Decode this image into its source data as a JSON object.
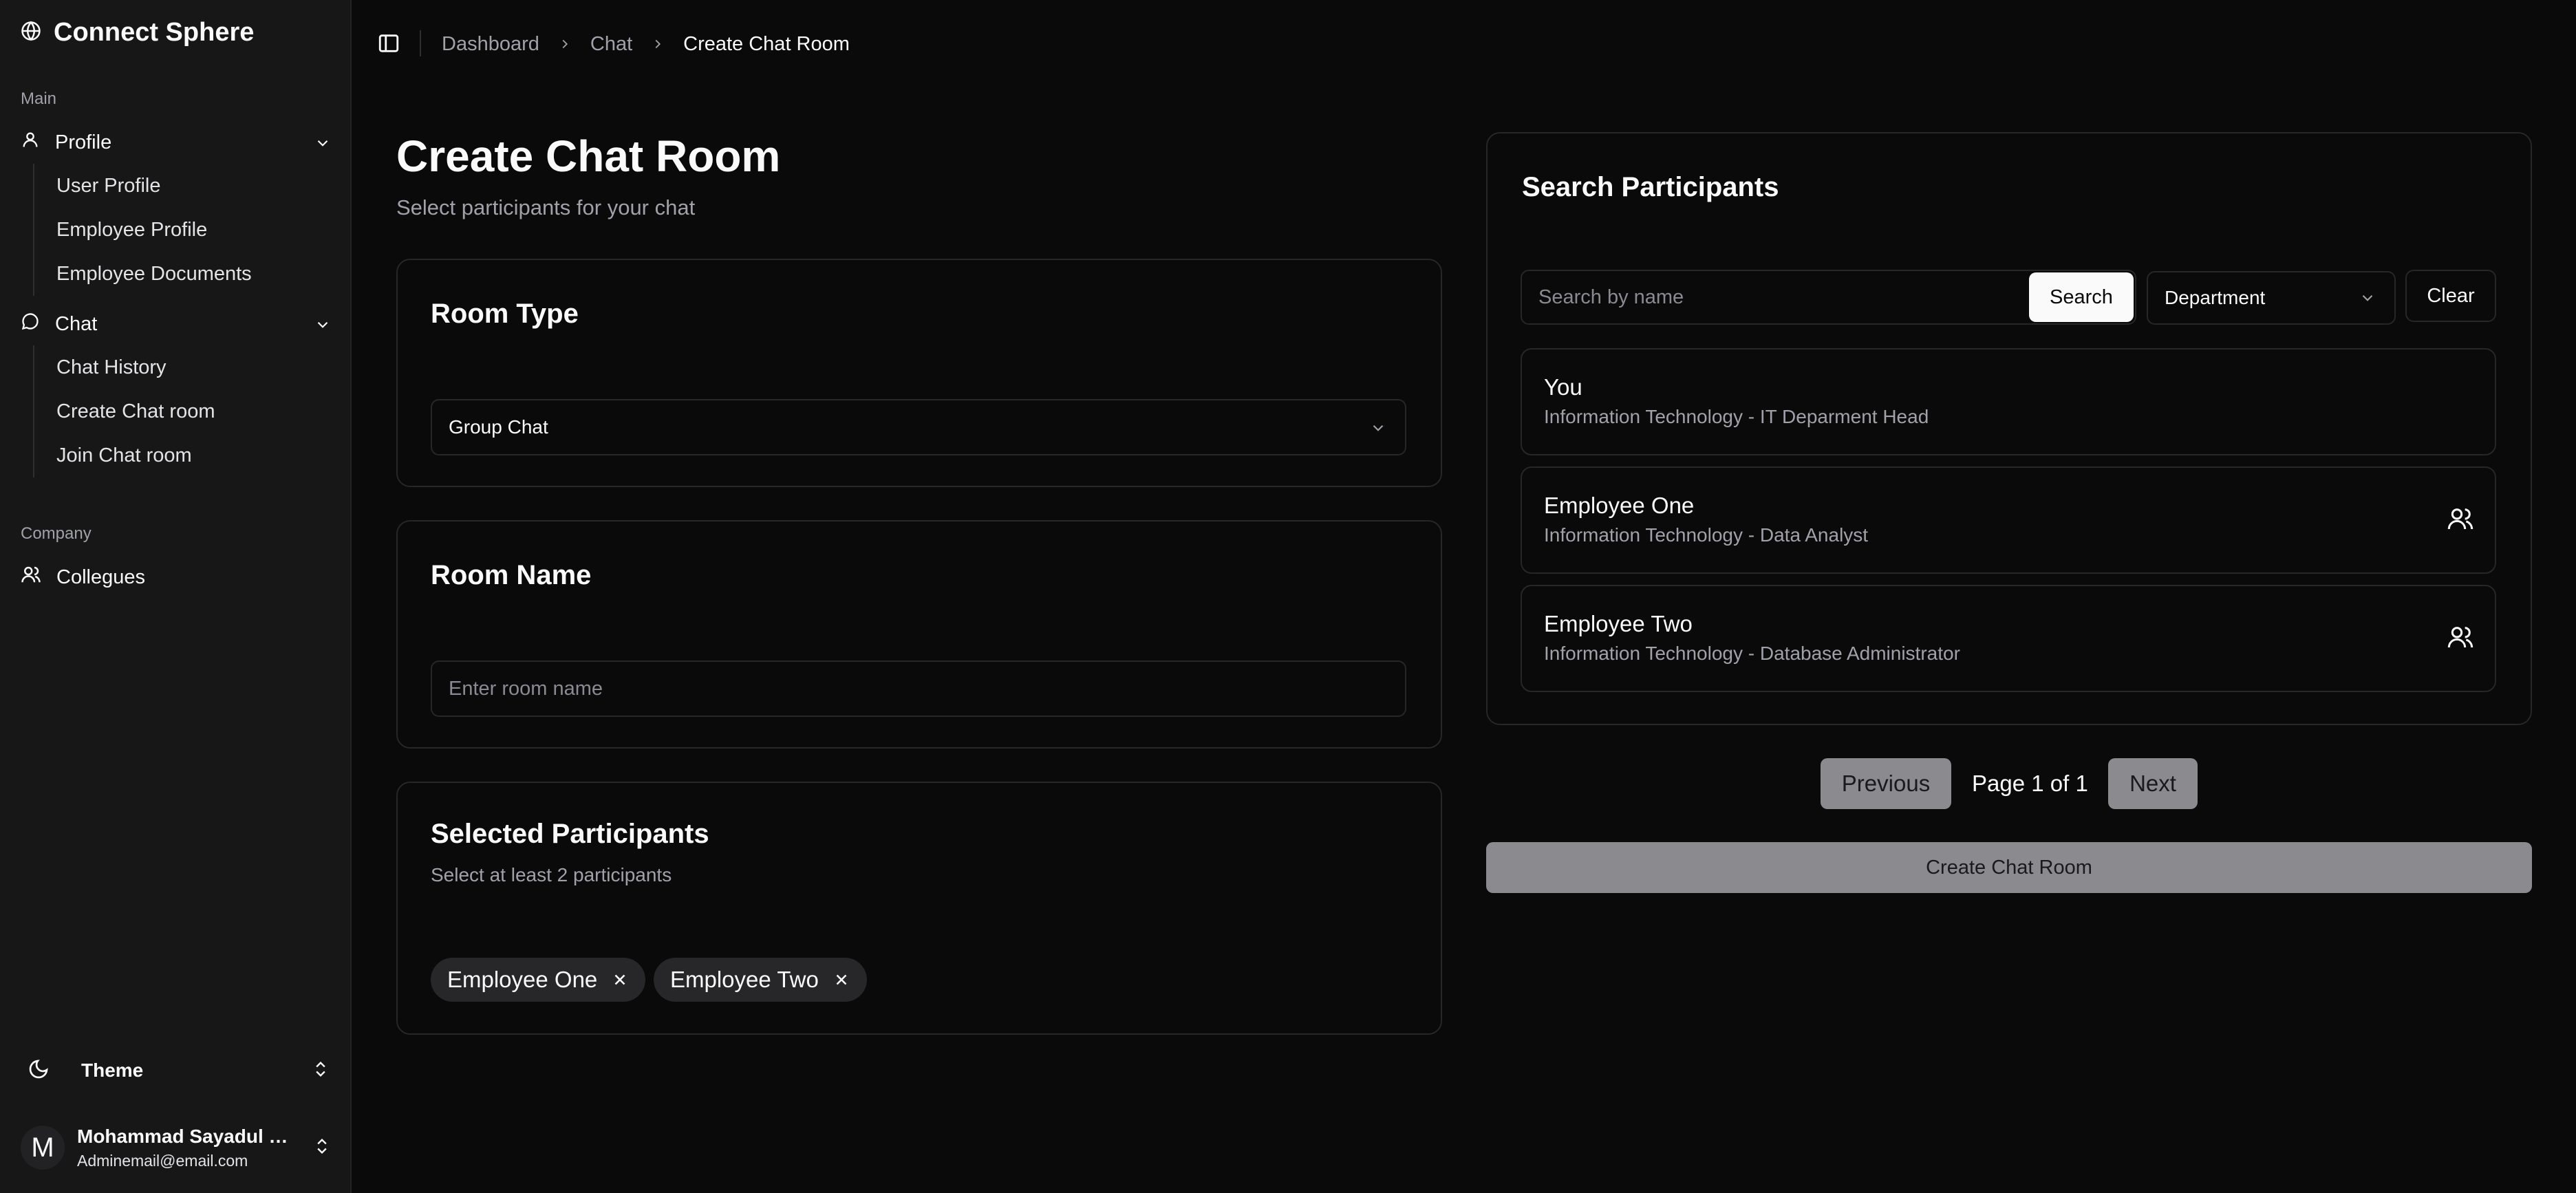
{
  "app": {
    "name": "Connect Sphere"
  },
  "sidebar": {
    "main_label": "Main",
    "profile": {
      "label": "Profile",
      "items": [
        "User Profile",
        "Employee Profile",
        "Employee Documents"
      ]
    },
    "chat": {
      "label": "Chat",
      "items": [
        "Chat History",
        "Create Chat room",
        "Join Chat room"
      ]
    },
    "company_label": "Company",
    "collegues_label": "Collegues",
    "theme_label": "Theme",
    "user": {
      "initial": "M",
      "name": "Mohammad Sayadul Islam",
      "email": "Adminemail@email.com"
    }
  },
  "breadcrumb": [
    "Dashboard",
    "Chat",
    "Create Chat Room"
  ],
  "page": {
    "title": "Create Chat Room",
    "subtitle": "Select participants for your chat"
  },
  "room_type": {
    "title": "Room Type",
    "value": "Group Chat"
  },
  "room_name": {
    "title": "Room Name",
    "placeholder": "Enter room name",
    "value": ""
  },
  "selected": {
    "title": "Selected Participants",
    "hint": "Select at least 2 participants",
    "chips": [
      "Employee One",
      "Employee Two"
    ]
  },
  "search": {
    "title": "Search Participants",
    "placeholder": "Search by name",
    "button": "Search",
    "department": "Department",
    "clear": "Clear"
  },
  "participants": [
    {
      "name": "You",
      "role": "Information Technology - IT Deparment Head",
      "icon": "users-icon",
      "show_icon": false
    },
    {
      "name": "Employee One",
      "role": "Information Technology - Data Analyst",
      "icon": "users-icon",
      "show_icon": true
    },
    {
      "name": "Employee Two",
      "role": "Information Technology - Database Administrator",
      "icon": "users-icon",
      "show_icon": true
    }
  ],
  "pagination": {
    "previous": "Previous",
    "page_text": "Page 1 of 1",
    "next": "Next"
  },
  "create_button": "Create Chat Room",
  "colors": {
    "background": "#0a0a0b",
    "sidebar": "#171718",
    "border": "#27272a",
    "muted_text": "#a1a1aa",
    "disabled_button": "#8a8a8f"
  }
}
